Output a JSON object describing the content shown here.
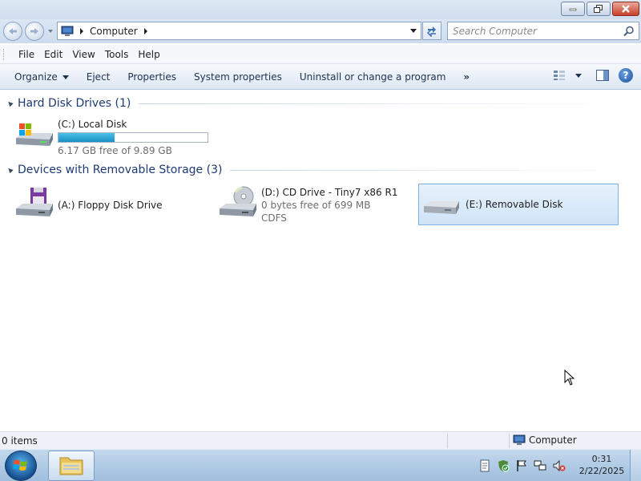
{
  "window": {
    "buttons": {
      "minimize": "minimize-icon",
      "maximize": "restore-icon",
      "close": "close-icon"
    }
  },
  "address": {
    "breadcrumb": "Computer",
    "search_placeholder": "Search Computer"
  },
  "menu": [
    "File",
    "Edit",
    "View",
    "Tools",
    "Help"
  ],
  "toolbar": {
    "organize": "Organize",
    "eject": "Eject",
    "properties": "Properties",
    "system_properties": "System properties",
    "uninstall": "Uninstall or change a program",
    "more": "»"
  },
  "groups": [
    {
      "title": "Hard Disk Drives (1)",
      "drives": [
        {
          "name": "(C:) Local Disk",
          "free": "6.17 GB free of 9.89 GB",
          "used_fraction": 0.376
        }
      ]
    },
    {
      "title": "Devices with Removable Storage (3)",
      "drives": [
        {
          "name": "(A:) Floppy Disk Drive"
        },
        {
          "name": "(D:) CD Drive - Tiny7 x86 R1",
          "free": "0 bytes free of 699 MB",
          "fs": "CDFS"
        },
        {
          "name": "(E:) Removable Disk"
        }
      ]
    }
  ],
  "status": {
    "count": "0 items",
    "location": "Computer"
  },
  "taskbar": {
    "time": "0:31",
    "date": "2/22/2025"
  },
  "colors": {
    "accent": "#1e3a73",
    "selection": "#cfe4f8",
    "capacity_fill": "#1b8fc4"
  }
}
